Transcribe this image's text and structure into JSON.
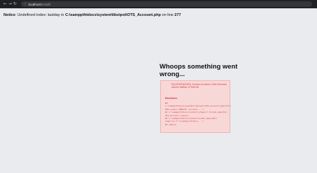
{
  "browser": {
    "url_host": "localhost",
    "url_path": "/install/"
  },
  "notice": {
    "label": "Notice",
    "text_prefix": ": Undefined index: lastday in ",
    "file": "C:\\xampp\\htdocs\\system\\libs\\pot\\OTS_Account.php",
    "line_prefix": " on line ",
    "line": "277"
  },
  "error": {
    "title": "Whoops something went wrong...",
    "sql_message": "SQLSTATE[42S22]: Column not found: 1054 Unknown column 'lastday' in 'field list'",
    "backtrace_label": "Backtrace:",
    "trace": "#0\nC:\\xampp\\htdocs\\system\\libs\\pot\\OTS_Account.php(277):\nPDO->exec('UPDATE `account...')\n#1 C:\\xampp\\htdocs\\install\\steps\\7-finish.php(53):\nOTS_Account->save()\n#2 C:\\xampp\\htdocs\\install\\index.php(216):\nrequire('C:\\\\xampp\\\\htdocs...')\n#3 {main}"
  }
}
